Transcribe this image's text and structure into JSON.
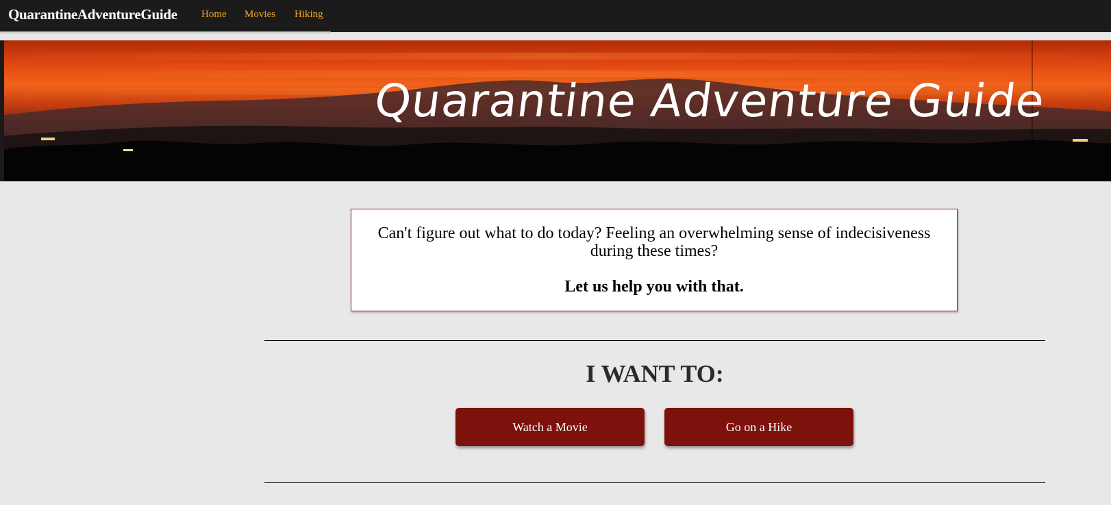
{
  "navbar": {
    "brand": "QuarantineAdventureGuide",
    "links": [
      "Home",
      "Movies",
      "Hiking"
    ]
  },
  "banner": {
    "title": "Quarantine Adventure Guide"
  },
  "intro": {
    "text": "Can't figure out what to do today? Feeling an overwhelming sense of indecisiveness during these times?",
    "emphasis": "Let us help you with that."
  },
  "main": {
    "heading": "I WANT TO:",
    "buttons": [
      "Watch a Movie",
      "Go on a Hike"
    ]
  },
  "colors": {
    "navbar_bg": "#1b1b1b",
    "nav_link": "#f5a623",
    "page_bg": "#e8e8e8",
    "button_bg": "#7d120d",
    "box_border": "#8b1a1a"
  }
}
